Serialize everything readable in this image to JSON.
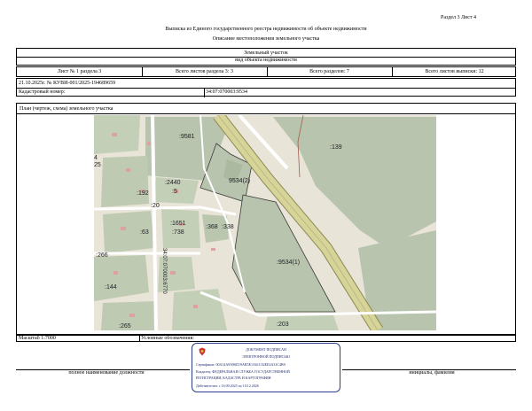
{
  "header": {
    "section_page": "Раздел 3   Лист 4",
    "title": "Выписка из Единого государственного реестра недвижимости об объекте недвижимости",
    "subtitle": "Описание местоположения земельного участка"
  },
  "object_block": {
    "name": "Земельный участок",
    "kind": "вид объекта недвижимости"
  },
  "sheet_row": {
    "sheet": "Лист № 1 раздела 3",
    "sheets_in_section": "Всего листов раздела 3: 3",
    "sections_total": "Всего разделов: 7",
    "sheets_total": "Всего листов выписки: 12"
  },
  "doc_info": {
    "date_number": "21.10.2025г. № КУВИ-001/2025-194689659",
    "cad_label": "Кадастровый номер:",
    "cad_number": "34:07:070003:9534"
  },
  "plan": {
    "caption": "План (чертеж, схема) земельного участка",
    "labels": {
      "l9581": ":9581",
      "l139": ":139",
      "l2440": ":2440",
      "l5": ":5",
      "l9534_2": "9534(2)",
      "l192": ":192",
      "l20": ":20",
      "l1651": ":1651",
      "l738": ":738",
      "l368": ":368",
      "l338": ":338",
      "l63": ":63",
      "l266": ":266",
      "l9534_1": ":9534(1)",
      "l144": ":144",
      "l265": ":265",
      "l203": ":203",
      "l4": "4",
      "l25": "25",
      "road": "34:07:070003:6770"
    }
  },
  "footer": {
    "scale": "Масштаб 1:7000",
    "legend": "Условные обозначения:",
    "position_label": "полное наименование должности",
    "initials_label": "инициалы, фамилия"
  },
  "stamp": {
    "line1": "ДОКУМЕНТ ПОДПИСАН",
    "line2": "ЭЛЕКТРОННОЙ ПОДПИСЬЮ",
    "line3": "Сертификат: 00A14A9A96D19AB5E1A61C02EE4A31C4B9",
    "line4": "Владелец: ФЕДЕРАЛЬНАЯ СЛУЖБА ГОСУДАРСТВЕННОЙ",
    "line5": "РЕГИСТРАЦИИ, КАДАСТРА И КАРТОГРАФИИ",
    "line6": "Действителен: с 16.09.2025 по 10.12.2026"
  },
  "colors": {
    "map_bg": "#e7e3d6",
    "parcel": "#b8c4ad",
    "road": "#d7d49a",
    "road_edge": "#8c8a52",
    "stamp": "#2b3e8f"
  }
}
